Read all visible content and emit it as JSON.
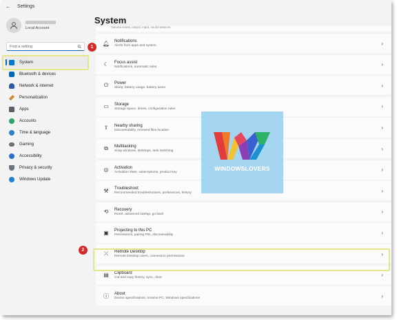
{
  "window": {
    "title": "Settings"
  },
  "profile": {
    "account_type": "Local Account"
  },
  "search": {
    "placeholder": "Find a setting"
  },
  "sidebar": {
    "items": [
      {
        "label": "System",
        "icon": "monitor-icon",
        "color": "#0078d4",
        "active": true
      },
      {
        "label": "Bluetooth & devices",
        "icon": "bluetooth-icon",
        "color": "#0067c0"
      },
      {
        "label": "Network & internet",
        "icon": "wifi-icon",
        "color": "#2b5aa8"
      },
      {
        "label": "Personalization",
        "icon": "brush-icon",
        "color": "#d08a3a"
      },
      {
        "label": "Apps",
        "icon": "apps-icon",
        "color": "#5a5f6a"
      },
      {
        "label": "Accounts",
        "icon": "person-icon",
        "color": "#2aa66a"
      },
      {
        "label": "Time & language",
        "icon": "globe-clock-icon",
        "color": "#2a82c8"
      },
      {
        "label": "Gaming",
        "icon": "gamepad-icon",
        "color": "#6b6f78"
      },
      {
        "label": "Accessibility",
        "icon": "accessibility-icon",
        "color": "#2a6fd0"
      },
      {
        "label": "Privacy & security",
        "icon": "shield-icon",
        "color": "#6b7380"
      },
      {
        "label": "Windows Update",
        "icon": "update-icon",
        "color": "#1f7fd8"
      }
    ]
  },
  "main": {
    "title": "System",
    "partial_row_text": "Volume levels, output, input, sound devices",
    "rows": [
      {
        "title": "Notifications",
        "subtitle": "Alerts from apps and system",
        "icon": "bell-icon"
      },
      {
        "title": "Focus assist",
        "subtitle": "Notifications, automatic rules",
        "icon": "moon-icon"
      },
      {
        "title": "Power",
        "subtitle": "Sleep, battery usage, battery saver",
        "icon": "power-icon"
      },
      {
        "title": "Storage",
        "subtitle": "Storage space, drives, configuration rules",
        "icon": "storage-icon"
      },
      {
        "title": "Nearby sharing",
        "subtitle": "Discoverability, received files location",
        "icon": "share-icon"
      },
      {
        "title": "Multitasking",
        "subtitle": "Snap windows, desktops, task switching",
        "icon": "multitask-icon"
      },
      {
        "title": "Activation",
        "subtitle": "Activation state, subscriptions, product key",
        "icon": "check-circle-icon"
      },
      {
        "title": "Troubleshoot",
        "subtitle": "Recommended troubleshooters, preferences, history",
        "icon": "wrench-icon"
      },
      {
        "title": "Recovery",
        "subtitle": "Reset, advanced startup, go back",
        "icon": "recovery-icon"
      },
      {
        "title": "Projecting to this PC",
        "subtitle": "Permissions, pairing PIN, discoverability",
        "icon": "projector-icon"
      },
      {
        "title": "Remote Desktop",
        "subtitle": "Remote Desktop users, connection permissions",
        "icon": "remote-desktop-icon"
      },
      {
        "title": "Clipboard",
        "subtitle": "Cut and copy history, sync, clear",
        "icon": "clipboard-icon"
      },
      {
        "title": "About",
        "subtitle": "Device specifications, rename PC, Windows specifications",
        "icon": "info-icon"
      }
    ]
  },
  "annotations": {
    "marker_1": "1",
    "marker_2": "2"
  },
  "watermark": {
    "text": "WINDOWSLOVERS"
  }
}
